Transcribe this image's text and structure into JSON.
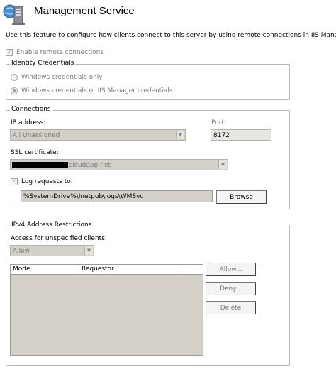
{
  "header": {
    "title": "Management Service",
    "description": "Use this feature to configure how clients connect to this server by using remote connections in IIS Manager."
  },
  "enable_remote": {
    "label": "Enable remote connections",
    "checked": true
  },
  "identity": {
    "legend": "Identity Credentials",
    "options": [
      {
        "label": "Windows credentials only",
        "selected": false
      },
      {
        "label": "Windows credentials or IIS Manager credentials",
        "selected": true
      }
    ]
  },
  "connections": {
    "legend": "Connections",
    "ip_label": "IP address:",
    "ip_value": "All Unassigned",
    "port_label": "Port:",
    "port_value": "8172",
    "ssl_label": "SSL certificate:",
    "ssl_value_suffix": "cloudapp.net",
    "log_label": "Log requests to:",
    "log_checked": true,
    "log_path": "%SystemDrive%\\Inetpub\\logs\\WMSvc",
    "browse_label": "Browse"
  },
  "ipv4": {
    "legend": "IPv4 Address Restrictions",
    "access_label": "Access for unspecified clients:",
    "access_value": "Allow",
    "columns": [
      "Mode",
      "Requestor"
    ],
    "buttons": {
      "allow": "Allow...",
      "deny": "Deny...",
      "delete": "Delete"
    }
  }
}
